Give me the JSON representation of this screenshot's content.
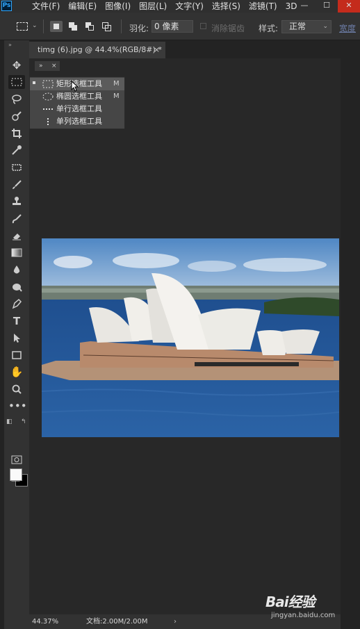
{
  "app": {
    "logo": "Ps"
  },
  "menu": [
    "文件(F)",
    "编辑(E)",
    "图像(I)",
    "图层(L)",
    "文字(Y)",
    "选择(S)",
    "滤镜(T)",
    "3D"
  ],
  "window_controls": {
    "minimize": "—",
    "maximize": "☐",
    "close": "✕"
  },
  "options": {
    "feather_label": "羽化:",
    "feather_value": "0 像素",
    "antialias_label": "消除锯齿",
    "style_label": "样式:",
    "style_value": "正常",
    "width_label": "宽度"
  },
  "document_tab": {
    "title": "timg (6).jpg @ 44.4%(RGB/8#) *",
    "close": "×"
  },
  "tool_flyout": {
    "items": [
      {
        "label": "矩形选框工具",
        "shortcut": "M",
        "icon": "rect-marquee-icon",
        "active": true
      },
      {
        "label": "椭圆选框工具",
        "shortcut": "M",
        "icon": "ellipse-marquee-icon",
        "active": false
      },
      {
        "label": "单行选框工具",
        "shortcut": "",
        "icon": "single-row-marquee-icon",
        "active": false
      },
      {
        "label": "单列选框工具",
        "shortcut": "",
        "icon": "single-column-marquee-icon",
        "active": false
      }
    ]
  },
  "status": {
    "zoom": "44.37%",
    "doc_info": "文档:2.00M/2.00M",
    "arrow": "›"
  },
  "watermark": {
    "main": "Bai经验",
    "sub": "jingyan.baidu.com"
  },
  "colors": {
    "foreground": "#fafafa",
    "background": "#000000",
    "accent": "#31a8ff"
  }
}
